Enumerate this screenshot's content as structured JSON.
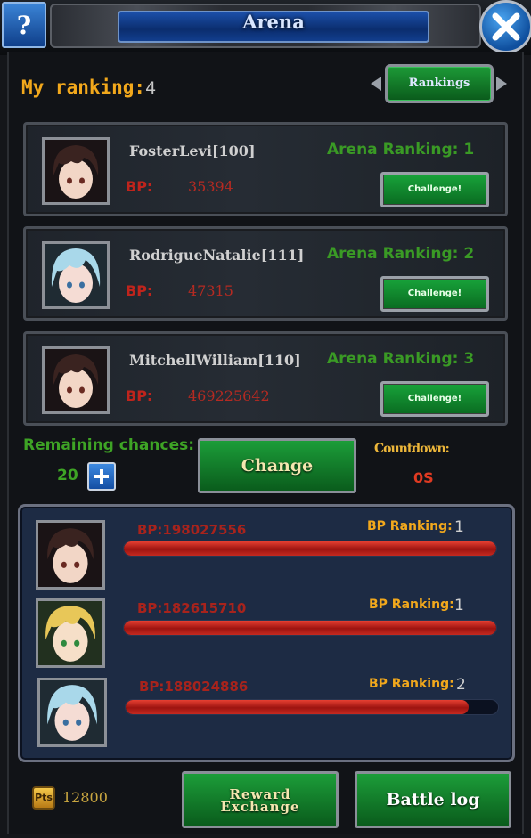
{
  "header": {
    "help_label": "?",
    "title": "Arena",
    "close_icon": "close-x-icon"
  },
  "my_ranking": {
    "label": "My ranking:",
    "value": "4"
  },
  "rankings_button": "Rankings",
  "opponents": [
    {
      "name": "FosterLevi[100]",
      "bp_label": "BP:",
      "bp": "35394",
      "rank_label": "Arena Ranking: 1",
      "challenge": "Challenge!",
      "avatar": "dark-hair-boy"
    },
    {
      "name": "RodrigueNatalie[111]",
      "bp_label": "BP:",
      "bp": "47315",
      "rank_label": "Arena Ranking: 2",
      "challenge": "Challenge!",
      "avatar": "silver-hair-girl"
    },
    {
      "name": "MitchellWilliam[110]",
      "bp_label": "BP:",
      "bp": "469225642",
      "rank_label": "Arena Ranking: 3",
      "challenge": "Challenge!",
      "avatar": "dark-hair-boy"
    }
  ],
  "remaining": {
    "label": "Remaining chances:",
    "value": "20"
  },
  "change_button": "Change",
  "countdown": {
    "label": "Countdown:",
    "value": "0S"
  },
  "bp_rankings": [
    {
      "bp": "BP:198027556",
      "rank_label": "BP Ranking:",
      "rank": "1",
      "fill": 1.0,
      "avatar": "dark-hair-boy"
    },
    {
      "bp": "BP:182615710",
      "rank_label": "BP Ranking:",
      "rank": "1",
      "fill": 1.0,
      "avatar": "blonde-elf"
    },
    {
      "bp": "BP:188024886",
      "rank_label": "BP Ranking:",
      "rank": "2",
      "fill": 0.92,
      "avatar": "silver-hair-girl"
    }
  ],
  "points": {
    "icon_label": "Pts",
    "value": "12800"
  },
  "reward_button": {
    "line1": "Reward",
    "line2": "Exchange"
  },
  "battle_log_button": "Battle log",
  "colors": {
    "accent_gold": "#f2a81c",
    "rank_green": "#3a9a25",
    "bp_red": "#c0241c",
    "button_green": "#1c9d39"
  }
}
